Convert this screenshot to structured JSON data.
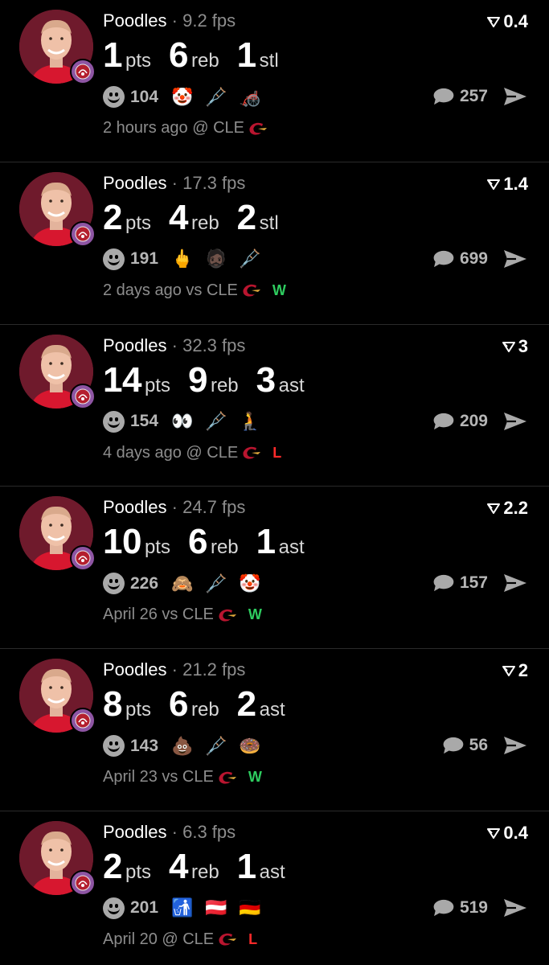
{
  "feed": {
    "cards": [
      {
        "name": "Poodles",
        "sep": "·",
        "fps": "9.2 fps",
        "score": "0.4",
        "stats": [
          {
            "num": "1",
            "lbl": "pts"
          },
          {
            "num": "6",
            "lbl": "reb"
          },
          {
            "num": "1",
            "lbl": "stl"
          }
        ],
        "reactions_count": "104",
        "emojis": [
          "🤡",
          "🩼",
          "🦽"
        ],
        "comments": "257",
        "time": "2 hours ago",
        "loc": "@ CLE",
        "result": ""
      },
      {
        "name": "Poodles",
        "sep": "·",
        "fps": "17.3 fps",
        "score": "1.4",
        "stats": [
          {
            "num": "2",
            "lbl": "pts"
          },
          {
            "num": "4",
            "lbl": "reb"
          },
          {
            "num": "2",
            "lbl": "stl"
          }
        ],
        "reactions_count": "191",
        "emojis": [
          "🖕",
          "🧔🏿",
          "🩼"
        ],
        "comments": "699",
        "time": "2 days ago",
        "loc": "vs CLE",
        "result": "W"
      },
      {
        "name": "Poodles",
        "sep": "·",
        "fps": "32.3 fps",
        "score": "3",
        "stats": [
          {
            "num": "14",
            "lbl": "pts"
          },
          {
            "num": "9",
            "lbl": "reb"
          },
          {
            "num": "3",
            "lbl": "ast"
          }
        ],
        "reactions_count": "154",
        "emojis": [
          "👀",
          "🩼",
          "🧎"
        ],
        "comments": "209",
        "time": "4 days ago",
        "loc": "@ CLE",
        "result": "L"
      },
      {
        "name": "Poodles",
        "sep": "·",
        "fps": "24.7 fps",
        "score": "2.2",
        "stats": [
          {
            "num": "10",
            "lbl": "pts"
          },
          {
            "num": "6",
            "lbl": "reb"
          },
          {
            "num": "1",
            "lbl": "ast"
          }
        ],
        "reactions_count": "226",
        "emojis": [
          "🙈",
          "🩼",
          "🤡"
        ],
        "comments": "157",
        "time": "April 26",
        "loc": "vs CLE",
        "result": "W"
      },
      {
        "name": "Poodles",
        "sep": "·",
        "fps": "21.2 fps",
        "score": "2",
        "stats": [
          {
            "num": "8",
            "lbl": "pts"
          },
          {
            "num": "6",
            "lbl": "reb"
          },
          {
            "num": "2",
            "lbl": "ast"
          }
        ],
        "reactions_count": "143",
        "emojis": [
          "💩",
          "🩼",
          "🍩"
        ],
        "comments": "56",
        "time": "April 23",
        "loc": "vs CLE",
        "result": "W"
      },
      {
        "name": "Poodles",
        "sep": "·",
        "fps": "6.3 fps",
        "score": "0.4",
        "stats": [
          {
            "num": "2",
            "lbl": "pts"
          },
          {
            "num": "4",
            "lbl": "reb"
          },
          {
            "num": "1",
            "lbl": "ast"
          }
        ],
        "reactions_count": "201",
        "emojis": [
          "🚮",
          "🇦🇹",
          "🇩🇪"
        ],
        "comments": "519",
        "time": "April 20",
        "loc": "@ CLE",
        "result": "L"
      }
    ]
  },
  "colors": {
    "background": "#000000",
    "muted_text": "#8d8d8d",
    "win": "#2ecc5f",
    "loss": "#ff2a2a",
    "avatar_bg": "#6f1a2c",
    "badge_bg": "#8e55a3"
  },
  "icons": [
    "upvote-caret-icon",
    "smiley-reaction-icon",
    "comment-bubble-icon",
    "send-icon",
    "cavaliers-logo-icon",
    "raptors-badge-icon"
  ]
}
